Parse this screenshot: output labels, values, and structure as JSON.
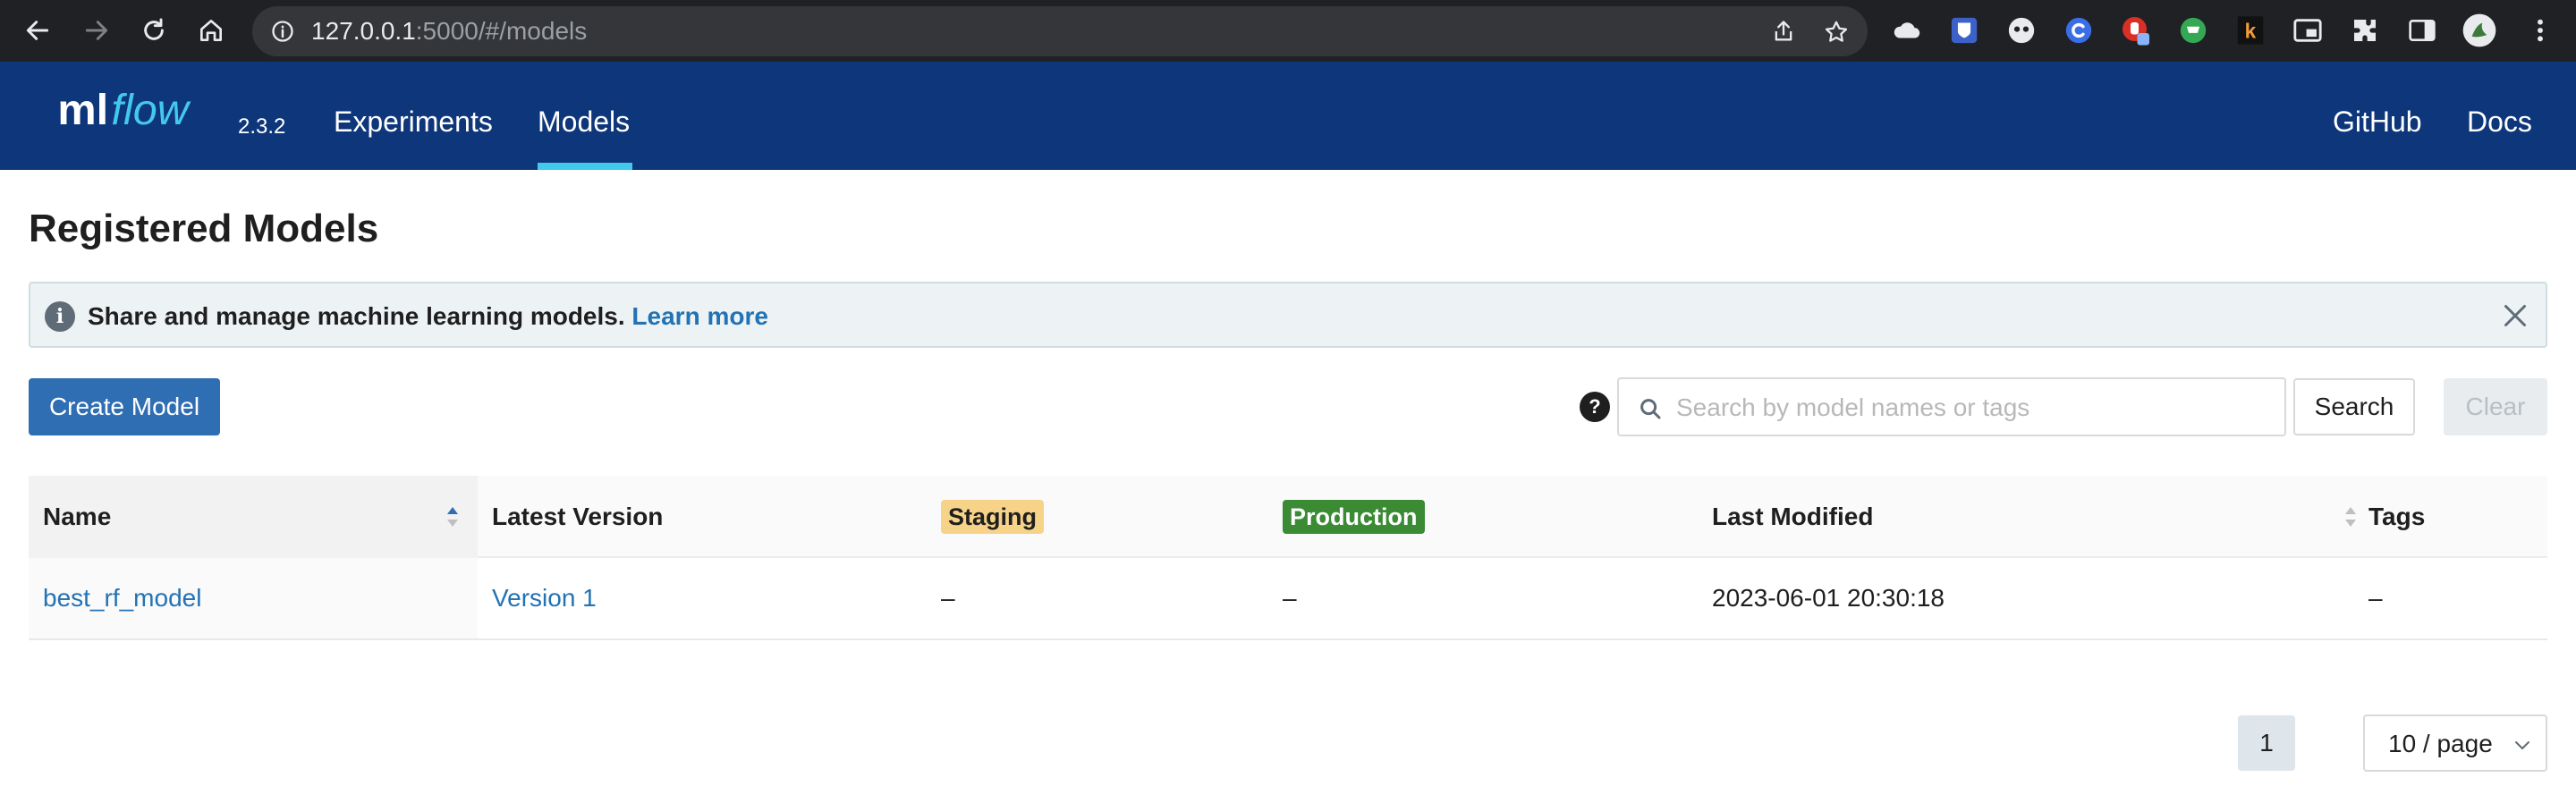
{
  "browser": {
    "url_host": "127.0.0.1",
    "url_rest": ":5000/#/models"
  },
  "header": {
    "version": "2.3.2",
    "nav": {
      "experiments": "Experiments",
      "models": "Models",
      "github": "GitHub",
      "docs": "Docs"
    }
  },
  "page": {
    "title": "Registered Models",
    "alert": {
      "message": "Share and manage machine learning models.",
      "link": "Learn more"
    },
    "create_button": "Create Model",
    "search": {
      "placeholder": "Search by model names or tags",
      "button": "Search",
      "clear": "Clear"
    }
  },
  "table": {
    "columns": {
      "name": "Name",
      "latest_version": "Latest Version",
      "staging": "Staging",
      "production": "Production",
      "last_modified": "Last Modified",
      "tags": "Tags"
    },
    "rows": [
      {
        "name": "best_rf_model",
        "latest_version": "Version 1",
        "staging": "–",
        "production": "–",
        "last_modified": "2023-06-01 20:30:18",
        "tags": "–"
      }
    ]
  },
  "pagination": {
    "current_page": "1",
    "page_size": "10 / page"
  },
  "colors": {
    "header_bg": "#0e367a",
    "accent": "#43c9ed",
    "primary": "#2f6eb3",
    "staging": "#f6d388",
    "production": "#3b8a34",
    "link": "#2272b4"
  }
}
